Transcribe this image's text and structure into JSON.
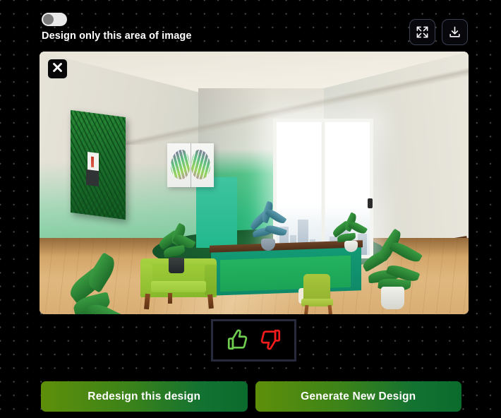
{
  "toolbar": {
    "toggle_label": "Design only this area of image",
    "toggle_state": "off",
    "fullscreen_icon": "fullscreen-expand-icon",
    "download_icon": "download-icon"
  },
  "image_panel": {
    "close_icon": "close-x-icon",
    "alt": "Interior design rendering of a green-themed room with armchair, desk, window and plants",
    "scene": {
      "walls": [
        "cream ceiling",
        "green gradient accent wall",
        "white right wall"
      ],
      "furniture": [
        "green armchair",
        "teal desk console",
        "green desk chair"
      ],
      "artwork": [
        "green fern panel",
        "monstera leaf diptych"
      ],
      "plants": [
        "monstera floor plant",
        "potted palm",
        "desk succulent",
        "windowsill fern",
        "areca palm"
      ],
      "floor": "light wood plank floor",
      "rug": "dark green round rug"
    },
    "colors": {
      "accent_wall": "#2fbd7f",
      "armchair": "#9ecb38",
      "desk": "#139a74",
      "floor": "#d2a468",
      "ceiling": "#f2eee3"
    }
  },
  "feedback": {
    "like_icon": "thumbs-up-icon",
    "dislike_icon": "thumbs-down-icon",
    "like_color": "#6ecc4e",
    "dislike_color": "#f21b1b"
  },
  "actions": {
    "redesign_label": "Redesign this design",
    "generate_label": "Generate New Design",
    "gradient_start": "#5e8f0a",
    "gradient_end": "#0a6b2c"
  },
  "theme": {
    "background": "#000000",
    "dot_grid": "#4a4a4a",
    "text": "#ffffff",
    "panel_border": "#262a3c"
  }
}
